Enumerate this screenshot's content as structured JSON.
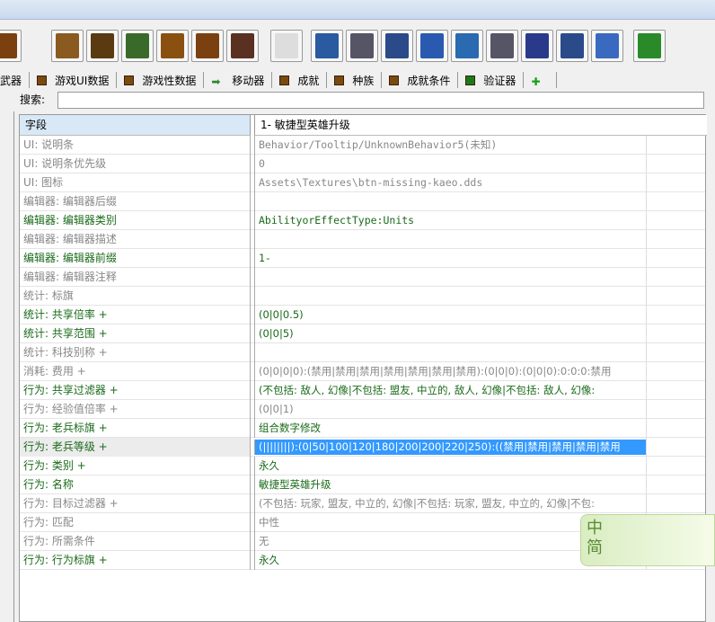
{
  "toolbar": {
    "icons": [
      "xml-icon",
      "table-icon",
      "table-xml-icon",
      "table-green-icon",
      "table-up-icon",
      "table-icon",
      "table-code-icon",
      "xml-down-icon",
      "mountain-icon",
      "gear-icon",
      "unit-icon",
      "font-icon",
      "import-icon",
      "face-icon",
      "list-icon",
      "film-icon",
      "splash-icon",
      "sc-icon"
    ]
  },
  "tabs": [
    {
      "label": "武器",
      "icon": "none"
    },
    {
      "label": "游戏UI数据",
      "icon": "table-icon"
    },
    {
      "label": "游戏性数据",
      "icon": "table-icon"
    },
    {
      "label": "移动器",
      "icon": "arrow-right-icon"
    },
    {
      "label": "成就",
      "icon": "table-icon"
    },
    {
      "label": "种族",
      "icon": "table-icon"
    },
    {
      "label": "成就条件",
      "icon": "table-icon"
    },
    {
      "label": "验证器",
      "icon": "validator-icon"
    },
    {
      "label": "",
      "icon": "plus-icon"
    }
  ],
  "search": {
    "label": "搜索:",
    "value": ""
  },
  "grid": {
    "field_header": "字段",
    "value_header": "1- 敏捷型英雄升级",
    "rows": [
      {
        "field": "UI: 说明条",
        "value": "Behavior/Tooltip/UnknownBehavior5(未知)",
        "modified": false,
        "mono": true
      },
      {
        "field": "UI: 说明条优先级",
        "value": "0",
        "modified": false,
        "mono": true
      },
      {
        "field": "UI: 图标",
        "value": "Assets\\Textures\\btn-missing-kaeo.dds",
        "modified": false,
        "mono": true
      },
      {
        "field": "编辑器: 编辑器后缀",
        "value": "",
        "modified": false
      },
      {
        "field": "编辑器: 编辑器类别",
        "value": "AbilityorEffectType:Units",
        "modified": true,
        "mono": true
      },
      {
        "field": "编辑器: 编辑器描述",
        "value": "",
        "modified": false
      },
      {
        "field": "编辑器: 编辑器前缀",
        "value": "1-",
        "modified": true,
        "mono": true
      },
      {
        "field": "编辑器: 编辑器注释",
        "value": "",
        "modified": false
      },
      {
        "field": "统计: 标旗",
        "value": "",
        "modified": false
      },
      {
        "field": "统计: 共享倍率 +",
        "value": "(0|0|0.5)",
        "modified": true
      },
      {
        "field": "统计: 共享范围 +",
        "value": "(0|0|5)",
        "modified": true
      },
      {
        "field": "统计: 科技别称 +",
        "value": "",
        "modified": false
      },
      {
        "field": "消耗: 费用 +",
        "value": "(0|0|0|0):(禁用|禁用|禁用|禁用|禁用|禁用|禁用):(0|0|0):(0|0|0):0:0:0:禁用",
        "modified": false
      },
      {
        "field": "行为: 共享过滤器 +",
        "value": "(不包括: 敌人, 幻像|不包括: 盟友, 中立的, 敌人, 幻像|不包括: 敌人, 幻像:",
        "modified": true
      },
      {
        "field": "行为: 经验值倍率 +",
        "value": "(0|0|1)",
        "modified": false
      },
      {
        "field": "行为: 老兵标旗 +",
        "value": "组合数字修改",
        "modified": true
      },
      {
        "field": "行为: 老兵等级 +",
        "value": "(||||||||):(0|50|100|120|180|200|200|220|250):((禁用|禁用|禁用|禁用|禁用",
        "modified": true,
        "selected": true
      },
      {
        "field": "行为: 类别 +",
        "value": "永久",
        "modified": true
      },
      {
        "field": "行为: 名称",
        "value": "敏捷型英雄升级",
        "modified": true
      },
      {
        "field": "行为: 目标过滤器 +",
        "value": "(不包括: 玩家, 盟友, 中立的, 幻像|不包括: 玩家, 盟友, 中立的, 幻像|不包:",
        "modified": false
      },
      {
        "field": "行为: 匹配",
        "value": "中性",
        "modified": false
      },
      {
        "field": "行为: 所需条件",
        "value": "无",
        "modified": false
      },
      {
        "field": "行为: 行为标旗 +",
        "value": "永久",
        "modified": true
      }
    ]
  },
  "ime": {
    "mode": "中",
    "variant": "简"
  }
}
